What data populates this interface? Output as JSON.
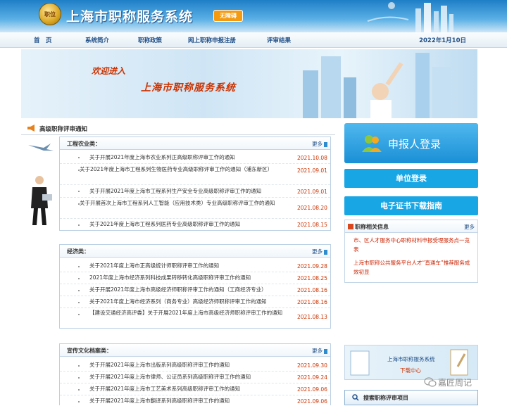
{
  "header": {
    "logo_text": "职位",
    "title": "上海市职称服务系统",
    "no_barrier_label": "无障碍"
  },
  "nav": {
    "items": [
      "首　页",
      "系统简介",
      "职称政策",
      "网上职称申报注册",
      "评审结果"
    ],
    "date": "2022年1月10日"
  },
  "banner": {
    "line1": "欢迎进入",
    "line2": "上海市职称服务系统"
  },
  "left": {
    "section_title": "高级职称评审通知",
    "more_label": "更多",
    "categories": [
      {
        "title": "工程农业类：",
        "items": [
          {
            "title": "关于开展2021年度上海市农业系列正高级职称评审工作的通知",
            "date": "2021.10.08"
          },
          {
            "title": "关于2021年度上海市工程系列生物医药专业高级职称评审工作的通知（浦东新区）",
            "date": "2021.09.01"
          },
          {
            "title": "关于开展2021年度上海市工程系列生产安全专业高级职称评审工作的通知",
            "date": "2021.09.01"
          },
          {
            "title": "关于开展首次上海市工程系列人工智能（应用技术类）专业高级职称评审工作的通知",
            "date": "2021.08.20"
          },
          {
            "title": "关于2021年度上海市工程系列医药专业高级职称评审工作的通知",
            "date": "2021.08.15"
          }
        ]
      },
      {
        "title": "经济类：",
        "items": [
          {
            "title": "关于2021年度上海市正高级统计师职称评审工作的通知",
            "date": "2021.09.28"
          },
          {
            "title": "2021年度上海市经济系列科技成果转移转化高级职称评审工作的通知",
            "date": "2021.08.25"
          },
          {
            "title": "关于开展2021年度上海市高级经济师职称评审工作的通知（工商经济专业）",
            "date": "2021.08.16"
          },
          {
            "title": "关于2021年度上海市经济系列（商务专业）高级经济师职称评审工作的通知",
            "date": "2021.08.16"
          },
          {
            "title": "【建设交通经济高评委】关于开展2021年度上海市高级经济师职称评审工作的通知",
            "date": "2021.08.13"
          }
        ]
      },
      {
        "title": "宣传文化档案类：",
        "items": [
          {
            "title": "关于开展2021年度上海市出版系列高级职称评审工作的通知",
            "date": "2021.09.30"
          },
          {
            "title": "关于开展2021年度上海市律师、公证员系列高级职称评审工作的通知",
            "date": "2021.09.24"
          },
          {
            "title": "关于开展2021年度上海市工艺美术系列高级职称评审工作的通知",
            "date": "2021.09.06"
          },
          {
            "title": "关于开展2021年度上海市翻译系列高级职称评审工作的通知",
            "date": "2021.09.06"
          }
        ]
      }
    ]
  },
  "right": {
    "declarant_login": "申报人登录",
    "unit_login": "单位登录",
    "cert_download": "电子证书下载指南",
    "info": {
      "title": "职称相关信息",
      "more_label": "更多",
      "items": [
        "市、区人才服务中心职称材料申报受理服务点一览表",
        "上海市职称公共服务平台人才“直通车”推荐服务成效初显"
      ]
    },
    "promo": {
      "title": "上海市职称服务系统",
      "subtitle": "下载中心"
    },
    "search_label": "搜索职称评审项目"
  },
  "watermark": "嘉匠周记"
}
